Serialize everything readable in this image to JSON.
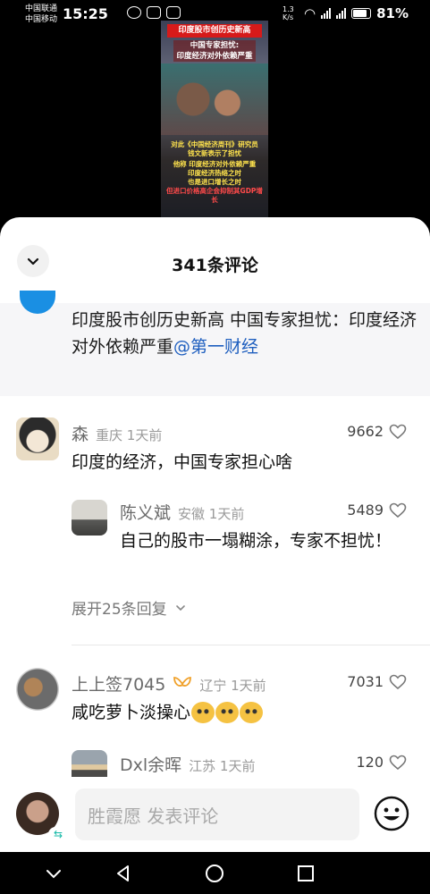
{
  "status_bar": {
    "carrier_1": "中国联通",
    "carrier_2": "中国移动",
    "time": "15:25",
    "net_speed": "1.3 K/s",
    "battery_pct": "81%",
    "battery_level": 0.81
  },
  "video": {
    "banner": "印度股市创历史新高",
    "subtitle_1": "中国专家担忧:",
    "subtitle_2": "印度经济对外依赖严重",
    "text_1": "对此《中国经济周刊》研究员",
    "text_2": "钱文新表示了担忧",
    "text_3": "他称 印度经济对外依赖严重",
    "text_4": "印度经济热络之时",
    "text_5": "也是进口增长之时",
    "text_6": "但进口价格高企会抑制其GDP增长"
  },
  "sheet": {
    "title": "341条评论",
    "pinned_text": "印度股市创历史新高 中国专家担忧：印度经济对外依赖严重",
    "pinned_mention": "@第一财经"
  },
  "comments": [
    {
      "name": "森",
      "location": "重庆 1天前",
      "likes": "9662",
      "text": "印度的经济，中国专家担心啥",
      "reply": {
        "name": "陈义斌",
        "location": "安徽 1天前",
        "likes": "5489",
        "text": "自己的股市一塌糊涂，专家不担忧！"
      },
      "expand": "展开25条回复"
    },
    {
      "name": "上上签7045",
      "location": "辽宁 1天前",
      "likes": "7031",
      "text": "咸吃萝卜淡操心",
      "reply": {
        "name": "Dxl余晖",
        "location": "江苏 1天前",
        "likes": "120"
      }
    }
  ],
  "input": {
    "placeholder": "胜霞愿 发表评论"
  },
  "icons": {
    "collapse": "chevron-down-icon",
    "like": "heart-outline-icon",
    "emoji": "smiley-icon"
  },
  "colors": {
    "mention": "#1f5fbf",
    "accent_blue": "#1a8fe3",
    "banner_red": "#d61a1a"
  }
}
